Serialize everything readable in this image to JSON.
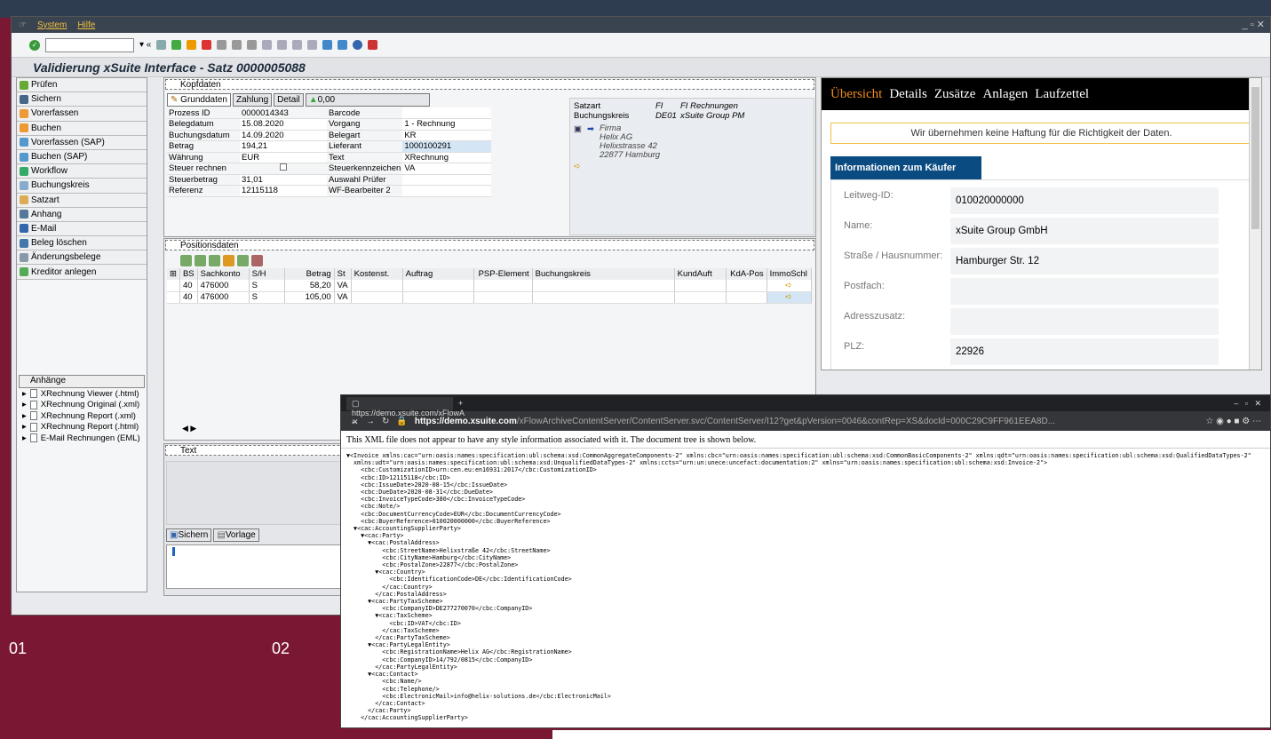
{
  "sap": {
    "menu": [
      "System",
      "Hilfe"
    ],
    "title": "Validierung xSuite Interface - Satz 0000005088",
    "nav_items": [
      "Prüfen",
      "Sichern",
      "Vorerfassen",
      "Buchen",
      "Vorerfassen (SAP)",
      "Buchen (SAP)",
      "Workflow",
      "Buchungskreis",
      "Satzart",
      "Anhang",
      "E-Mail",
      "Beleg löschen",
      "Änderungsbelege",
      "Kreditor anlegen"
    ],
    "attach_header": "Anhänge",
    "attachments": [
      "XRechnung Viewer (.html)",
      "XRechnung Original (.xml)",
      "XRechnung Report (.xml)",
      "XRechnung Report (.html)",
      "E-Mail Rechnungen (EML)"
    ],
    "kopf_header": "Kopfdaten",
    "tabs": [
      "Grunddaten",
      "Zahlung",
      "Detail"
    ],
    "tab_amount": "0,00",
    "fields": [
      {
        "l1": "Prozess ID",
        "v1": "0000014343",
        "l2": "Barcode",
        "v2": ""
      },
      {
        "l1": "Belegdatum",
        "v1": "15.08.2020",
        "l2": "Vorgang",
        "v2": "1 - Rechnung"
      },
      {
        "l1": "Buchungsdatum",
        "v1": "14.09.2020",
        "l2": "Belegart",
        "v2": "KR"
      },
      {
        "l1": "Betrag",
        "v1": "194,21",
        "l2": "Lieferant",
        "v2": "1000100291"
      },
      {
        "l1": "Währung",
        "v1": "EUR",
        "l2": "Text",
        "v2": "XRechnung"
      },
      {
        "l1": "Steuer rechnen",
        "v1": "",
        "l2": "Steuerkennzeichen",
        "v2": "VA"
      },
      {
        "l1": "Steuerbetrag",
        "v1": "31,01",
        "l2": "Auswahl Prüfer",
        "v2": ""
      },
      {
        "l1": "Referenz",
        "v1": "12115118",
        "l2": "WF-Bearbeiter 2",
        "v2": ""
      }
    ],
    "satzart_label": "Satzart",
    "satzart_code": "FI",
    "satzart_text": "FI Rechnungen",
    "bukrs_label": "Buchungskreis",
    "bukrs_code": "DE01",
    "bukrs_text": "xSuite Group PM",
    "vendor": [
      "Firma",
      "Helix AG",
      "Helixstrasse 42",
      "22877 Hamburg"
    ],
    "pos_header": "Positionsdaten",
    "pos_columns": [
      "BS",
      "Sachkonto",
      "S/H",
      "Betrag",
      "St",
      "Kostenst.",
      "Auftrag",
      "PSP-Element",
      "Buchungskreis",
      "KundAuft",
      "KdA-Pos",
      "ImmoSchl"
    ],
    "pos_rows": [
      [
        "40",
        "476000",
        "S",
        "58,20",
        "VA"
      ],
      [
        "40",
        "476000",
        "S",
        "105,00",
        "VA"
      ]
    ],
    "text_header": "Text",
    "text_buttons": [
      "Sichern",
      "Vorlage"
    ]
  },
  "viewer": {
    "tabs": [
      "Übersicht",
      "Details",
      "Zusätze",
      "Anlagen",
      "Laufzettel"
    ],
    "disclaimer": "Wir übernehmen keine Haftung für die Richtigkeit der Daten.",
    "section": "Informationen zum Käufer",
    "rows": [
      {
        "label": "Leitweg-ID:",
        "value": "010020000000"
      },
      {
        "label": "Name:",
        "value": "xSuite Group GmbH"
      },
      {
        "label": "Straße / Hausnummer:",
        "value": "Hamburger Str. 12"
      },
      {
        "label": "Postfach:",
        "value": ""
      },
      {
        "label": "Adresszusatz:",
        "value": ""
      },
      {
        "label": "PLZ:",
        "value": "22926"
      }
    ]
  },
  "browser": {
    "tab_title": "https://demo.xsuite.com/xFlowA",
    "url_host": "https://demo.xsuite.com",
    "url_path": "/xFlowArchiveContentServer/ContentServer.svc/ContentServer/I12?get&pVersion=0046&contRep=XS&docId=000C29C9FF961EEA8D...",
    "notice": "This XML file does not appear to have any style information associated with it. The document tree is shown below.",
    "xml_lines": [
      "▼<Invoice xmlns:cac=\"urn:oasis:names:specification:ubl:schema:xsd:CommonAggregateComponents-2\" xmlns:cbc=\"urn:oasis:names:specification:ubl:schema:xsd:CommonBasicComponents-2\" xmlns:qdt=\"urn:oasis:names:specification:ubl:schema:xsd:QualifiedDataTypes-2\"",
      "  xmlns:udt=\"urn:oasis:names:specification:ubl:schema:xsd:UnqualifiedDataTypes-2\" xmlns:ccts=\"urn:un:unece:uncefact:documentation:2\" xmlns=\"urn:oasis:names:specification:ubl:schema:xsd:Invoice-2\">",
      "    <cbc:CustomizationID>urn:cen.eu:en16931:2017</cbc:CustomizationID>",
      "    <cbc:ID>12115118</cbc:ID>",
      "    <cbc:IssueDate>2020-08-15</cbc:IssueDate>",
      "    <cbc:DueDate>2020-08-31</cbc:DueDate>",
      "    <cbc:InvoiceTypeCode>380</cbc:InvoiceTypeCode>",
      "    <cbc:Note/>",
      "    <cbc:DocumentCurrencyCode>EUR</cbc:DocumentCurrencyCode>",
      "    <cbc:BuyerReference>010020000000</cbc:BuyerReference>",
      "  ▼<cac:AccountingSupplierParty>",
      "    ▼<cac:Party>",
      "      ▼<cac:PostalAddress>",
      "          <cbc:StreetName>Helixstraße 42</cbc:StreetName>",
      "          <cbc:CityName>Hamburg</cbc:CityName>",
      "          <cbc:PostalZone>22877</cbc:PostalZone>",
      "        ▼<cac:Country>",
      "            <cbc:IdentificationCode>DE</cbc:IdentificationCode>",
      "          </cac:Country>",
      "        </cac:PostalAddress>",
      "      ▼<cac:PartyTaxScheme>",
      "          <cbc:CompanyID>DE277270070</cbc:CompanyID>",
      "        ▼<cac:TaxScheme>",
      "            <cbc:ID>VAT</cbc:ID>",
      "          </cac:TaxScheme>",
      "        </cac:PartyTaxScheme>",
      "      ▼<cac:PartyLegalEntity>",
      "          <cbc:RegistrationName>Helix AG</cbc:RegistrationName>",
      "          <cbc:CompanyID>14/792/0815</cbc:CompanyID>",
      "        </cac:PartyLegalEntity>",
      "      ▼<cac:Contact>",
      "          <cbc:Name/>",
      "          <cbc:Telephone/>",
      "          <cbc:ElectronicMail>info@helix-solutions.de</cbc:ElectronicMail>",
      "        </cac:Contact>",
      "      </cac:Party>",
      "    </cac:AccountingSupplierParty>"
    ]
  },
  "labels": {
    "n1": "01",
    "n2": "02"
  }
}
